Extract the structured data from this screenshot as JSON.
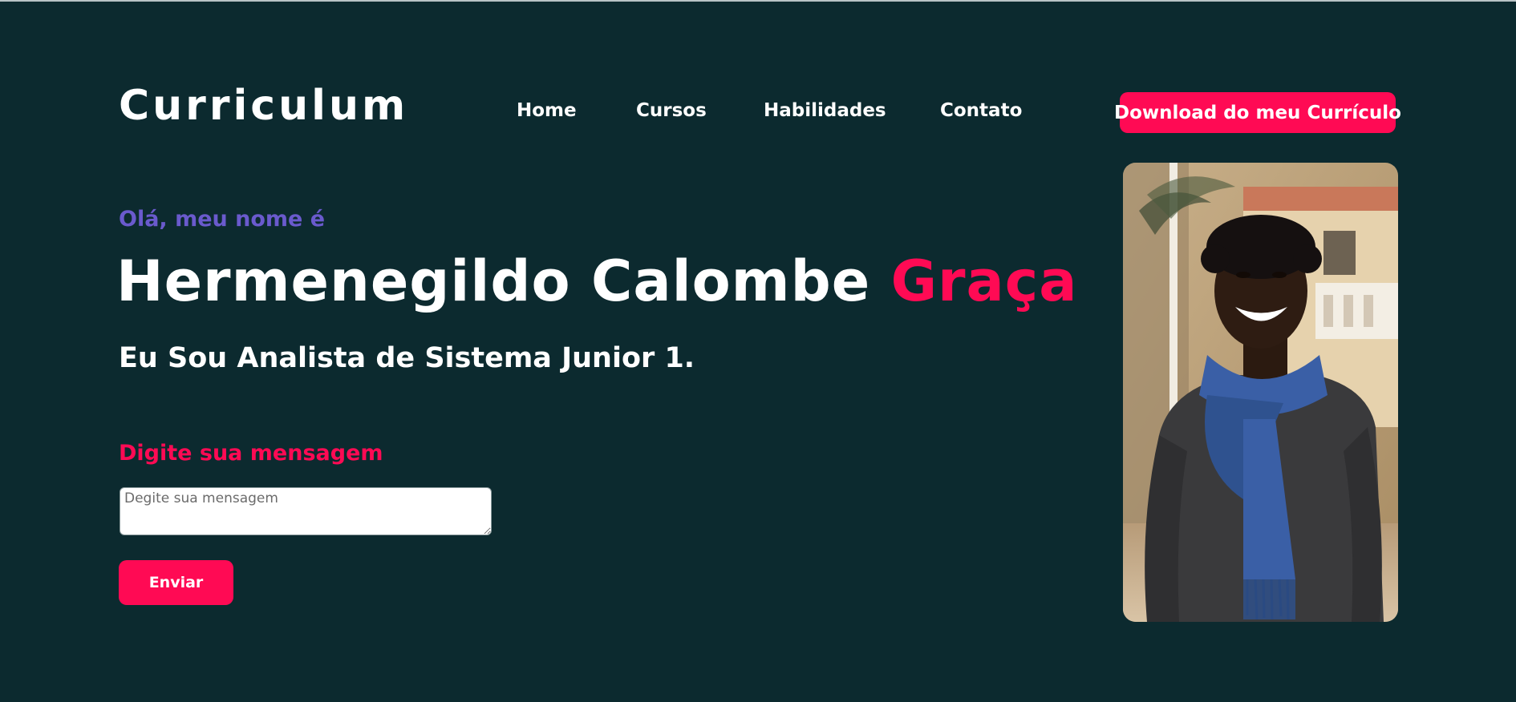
{
  "header": {
    "logo": "Curriculum",
    "nav": [
      "Home",
      "Cursos",
      "Habilidades",
      "Contato"
    ],
    "download_label": "Download do meu Currículo"
  },
  "hero": {
    "greeting": "Olá, meu nome é",
    "name_main": "Hermenegildo Calombe ",
    "name_accent": "Graça",
    "role": "Eu Sou Analista de Sistema Junior 1."
  },
  "message": {
    "label": "Digite sua mensagem",
    "placeholder": "Degite sua mensagem",
    "value": "",
    "send_label": "Enviar"
  },
  "colors": {
    "background": "#0c2a2f",
    "accent": "#ff0a54",
    "greeting": "#6a5acd"
  }
}
